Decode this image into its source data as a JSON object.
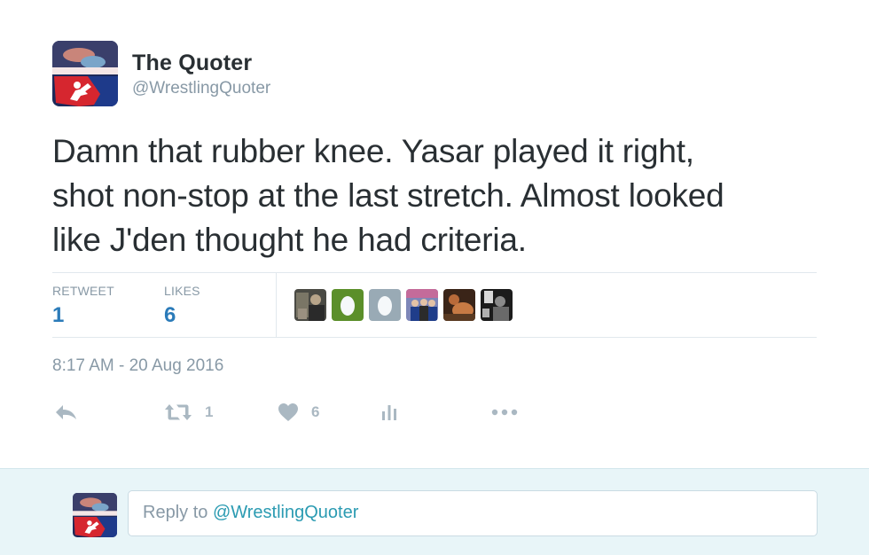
{
  "author": {
    "name": "The Quoter",
    "handle": "@WrestlingQuoter",
    "avatar_icon": "wrestling-logo-avatar"
  },
  "tweet": {
    "text_lines": [
      "Damn that rubber knee. Yasar played it right,",
      "shot non-stop at the last stretch. Almost looked",
      "like J'den thought he had criteria."
    ]
  },
  "stats": {
    "retweets_label": "RETWEET",
    "retweets_value": "1",
    "likes_label": "LIKES",
    "likes_value": "6",
    "likers": [
      "liker-photo-1",
      "egg-green",
      "egg-gray",
      "liker-photo-2",
      "liker-photo-3",
      "liker-photo-4"
    ]
  },
  "timestamp": "8:17 AM - 20 Aug 2016",
  "actions": {
    "reply_icon": "reply-icon",
    "retweet_count": "1",
    "like_count": "6",
    "analytics_icon": "analytics-icon",
    "more_icon": "more-icon"
  },
  "reply_box": {
    "prefix": "Reply to ",
    "mention": "@WrestlingQuoter"
  },
  "colors": {
    "accent": "#2b7bb9",
    "muted": "#8899a6",
    "reply_bar_bg": "#e8f5f8",
    "egg_green": "#5b8f2a",
    "egg_gray": "#99aab5"
  }
}
